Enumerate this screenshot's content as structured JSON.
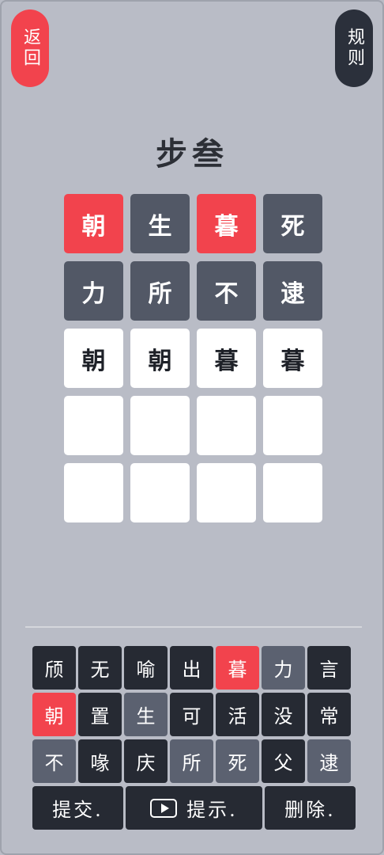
{
  "header": {
    "back_label": "返回",
    "rules_label": "规则",
    "title": "步叁"
  },
  "board": [
    [
      {
        "char": "朝",
        "state": "red"
      },
      {
        "char": "生",
        "state": "gray"
      },
      {
        "char": "暮",
        "state": "red"
      },
      {
        "char": "死",
        "state": "gray"
      }
    ],
    [
      {
        "char": "力",
        "state": "gray"
      },
      {
        "char": "所",
        "state": "gray"
      },
      {
        "char": "不",
        "state": "gray"
      },
      {
        "char": "逮",
        "state": "gray"
      }
    ],
    [
      {
        "char": "朝",
        "state": "white"
      },
      {
        "char": "朝",
        "state": "white"
      },
      {
        "char": "暮",
        "state": "white"
      },
      {
        "char": "暮",
        "state": "white"
      }
    ],
    [
      {
        "char": "",
        "state": "white"
      },
      {
        "char": "",
        "state": "white"
      },
      {
        "char": "",
        "state": "white"
      },
      {
        "char": "",
        "state": "white"
      }
    ],
    [
      {
        "char": "",
        "state": "white"
      },
      {
        "char": "",
        "state": "white"
      },
      {
        "char": "",
        "state": "white"
      },
      {
        "char": "",
        "state": "white"
      }
    ]
  ],
  "keyboard": [
    {
      "char": "颀",
      "state": "dark"
    },
    {
      "char": "无",
      "state": "dark"
    },
    {
      "char": "喻",
      "state": "dark"
    },
    {
      "char": "出",
      "state": "dark"
    },
    {
      "char": "暮",
      "state": "red"
    },
    {
      "char": "力",
      "state": "gray"
    },
    {
      "char": "言",
      "state": "dark"
    },
    {
      "char": "朝",
      "state": "red"
    },
    {
      "char": "置",
      "state": "dark"
    },
    {
      "char": "生",
      "state": "gray"
    },
    {
      "char": "可",
      "state": "dark"
    },
    {
      "char": "活",
      "state": "dark"
    },
    {
      "char": "没",
      "state": "dark"
    },
    {
      "char": "常",
      "state": "dark"
    },
    {
      "char": "不",
      "state": "gray"
    },
    {
      "char": "喙",
      "state": "dark"
    },
    {
      "char": "庆",
      "state": "dark"
    },
    {
      "char": "所",
      "state": "gray"
    },
    {
      "char": "死",
      "state": "gray"
    },
    {
      "char": "父",
      "state": "dark"
    },
    {
      "char": "逮",
      "state": "gray"
    }
  ],
  "actions": {
    "submit_label": "提交.",
    "hint_label": "提示.",
    "delete_label": "删除."
  }
}
